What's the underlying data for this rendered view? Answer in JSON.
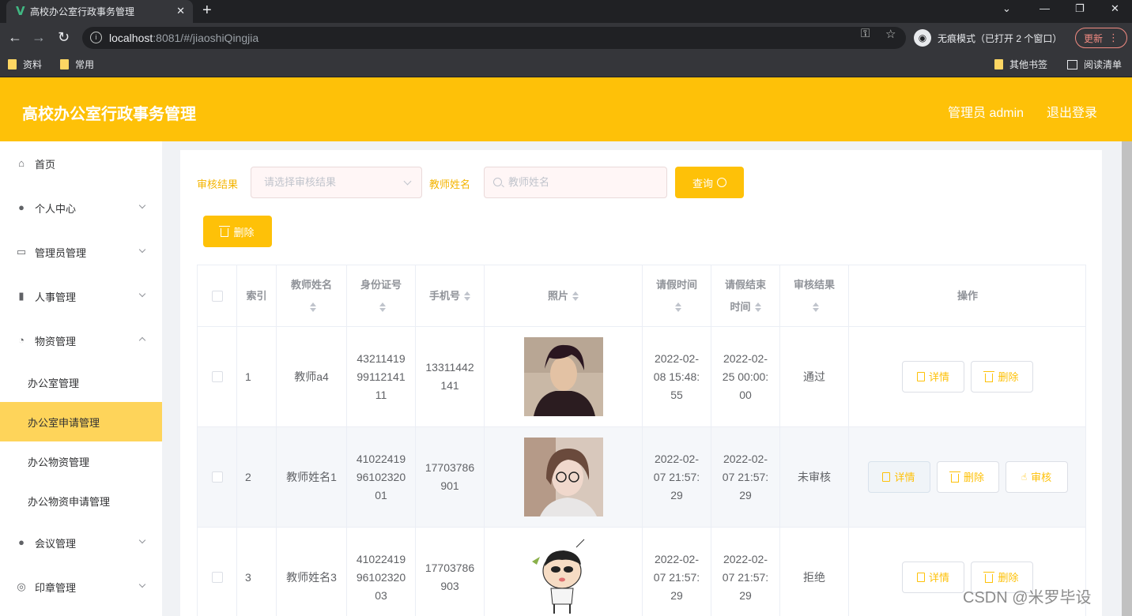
{
  "browser": {
    "tab_title": "高校办公室行政事务管理",
    "favicon": "V",
    "url_host": "localhost",
    "url_rest": ":8081/#/jiaoshiQingjia",
    "incognito_label": "无痕模式（已打开 2 个窗口）",
    "update_label": "更新",
    "bookmarks": [
      "资料",
      "常用"
    ],
    "bookmarks_right": [
      "其他书签",
      "阅读清单"
    ]
  },
  "header": {
    "title": "高校办公室行政事务管理",
    "admin": "管理员 admin",
    "logout": "退出登录"
  },
  "sidebar": {
    "items": [
      {
        "label": "首页",
        "icon": "home-icon"
      },
      {
        "label": "个人中心",
        "icon": "user-icon"
      },
      {
        "label": "管理员管理",
        "icon": "id-card-icon"
      },
      {
        "label": "人事管理",
        "icon": "bar-chart-icon"
      },
      {
        "label": "物资管理",
        "icon": "compass-icon"
      },
      {
        "label": "会议管理",
        "icon": "bulb-icon"
      },
      {
        "label": "印章管理",
        "icon": "stamp-icon"
      }
    ],
    "subitems": [
      "办公室管理",
      "办公室申请管理",
      "办公物资管理",
      "办公物资申请管理"
    ]
  },
  "filters": {
    "result_label": "审核结果",
    "result_placeholder": "请选择审核结果",
    "name_label": "教师姓名",
    "name_placeholder": "教师姓名",
    "query_button": "查询",
    "delete_button": "删除"
  },
  "table": {
    "headers": [
      "索引",
      "教师姓名",
      "身份证号",
      "手机号",
      "照片",
      "请假时间",
      "请假结束时间",
      "审核结果",
      "操作"
    ],
    "rows": [
      {
        "index": "1",
        "name": "教师a4",
        "id_card": "43211419\n99112141\n11",
        "phone": "13311442\n141",
        "start": "2022-02-\n08 15:48:\n55",
        "end": "2022-02-\n25 00:00:\n00",
        "result": "通过"
      },
      {
        "index": "2",
        "name": "教师姓名1",
        "id_card": "41022419\n96102320\n01",
        "phone": "17703786\n901",
        "start": "2022-02-\n07 21:57:\n29",
        "end": "2022-02-\n07 21:57:\n29",
        "result": "未审核"
      },
      {
        "index": "3",
        "name": "教师姓名3",
        "id_card": "41022419\n96102320\n03",
        "phone": "17703786\n903",
        "start": "2022-02-\n07 21:57:\n29",
        "end": "2022-02-\n07 21:57:\n29",
        "result": "拒绝"
      }
    ],
    "op_detail": "详情",
    "op_delete": "删除",
    "op_review": "审核"
  },
  "watermark": "CSDN @米罗毕设",
  "colors": {
    "accent": "#fec108",
    "active_sub": "#fed45a"
  }
}
